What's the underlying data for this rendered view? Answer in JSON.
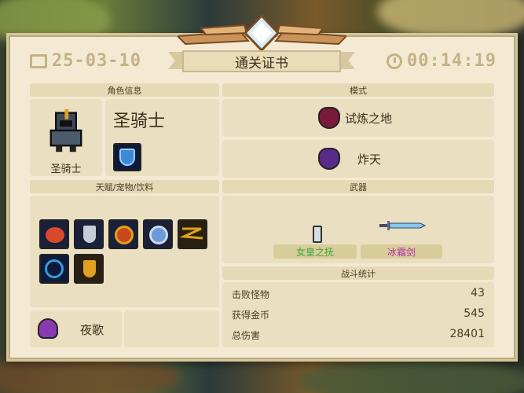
{
  "header": {
    "date": "25-03-10",
    "title": "通关证书",
    "time": "00:14:19"
  },
  "character": {
    "section_title": "角色信息",
    "name": "圣骑士",
    "portrait_label": "圣骑士",
    "skill_icon": "shield-skill-icon"
  },
  "mode": {
    "section_title": "模式",
    "items": [
      {
        "label": "试炼之地",
        "icon": "demon-mask-icon"
      },
      {
        "label": "炸天",
        "icon": "purple-demon-icon"
      }
    ]
  },
  "talents": {
    "section_title": "天赋/宠物/饮料",
    "icons": [
      "fire-attack-icon",
      "silver-shield-icon",
      "fire-shield-icon",
      "blue-shield-icon",
      "lightning-icon",
      "hourglass-icon",
      "gold-shield-icon"
    ],
    "pet": {
      "label": "夜歌",
      "icon": "bat-icon"
    }
  },
  "weapons": {
    "section_title": "武器",
    "items": [
      {
        "label": "女皇之抚",
        "color": "#3aa83a",
        "icon": "gauntlet-icon"
      },
      {
        "label": "冰霜剑",
        "color": "#b02ab0",
        "icon": "ice-sword-icon"
      }
    ]
  },
  "stats": {
    "section_title": "战斗统计",
    "rows": [
      {
        "label": "击败怪物",
        "value": "43"
      },
      {
        "label": "获得金币",
        "value": "545"
      },
      {
        "label": "总伤害",
        "value": "28401"
      }
    ]
  }
}
